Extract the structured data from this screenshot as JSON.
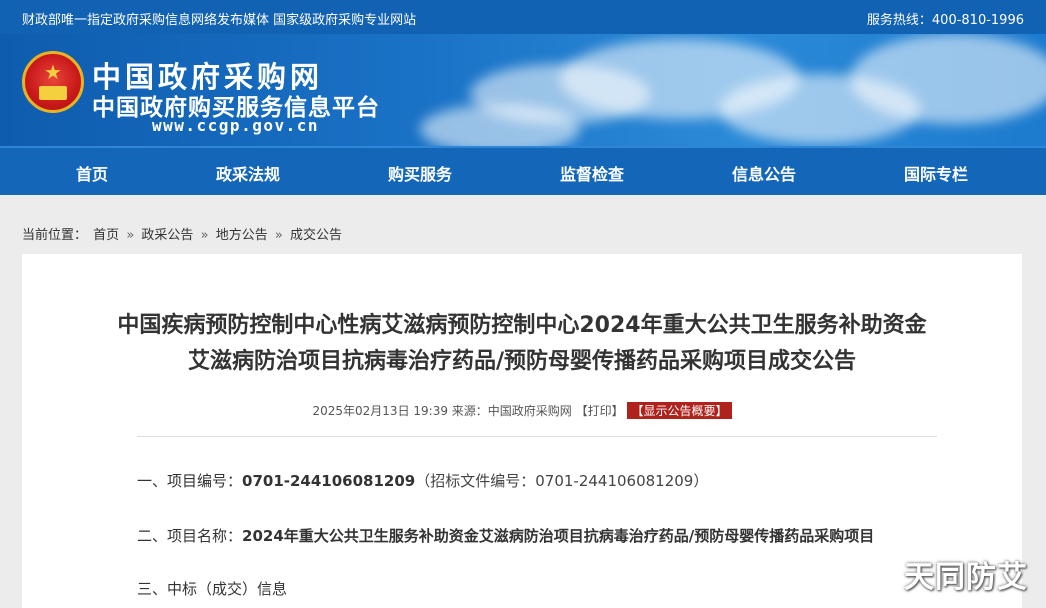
{
  "topbar": {
    "left_text": "财政部唯一指定政府采购信息网络发布媒体 国家级政府采购专业网站",
    "hotline": "服务热线：400-810-1996"
  },
  "logo": {
    "title_line1": "中国政府采购网",
    "title_line2": "中国政府购买服务信息平台",
    "url": "www.ccgp.gov.cn"
  },
  "nav": {
    "items": [
      "首页",
      "政采法规",
      "购买服务",
      "监督检查",
      "信息公告",
      "国际专栏"
    ]
  },
  "breadcrumb": {
    "label": "当前位置：",
    "items": [
      "首页",
      "政采公告",
      "地方公告",
      "成交公告"
    ],
    "separator": "»"
  },
  "article": {
    "title_line1": "中国疾病预防控制中心性病艾滋病预防控制中心2024年重大公共卫生服务补助资金",
    "title_line2": "艾滋病防治项目抗病毒治疗药品/预防母婴传播药品采购项目成交公告",
    "meta_date": "2025年02月13日 19:39",
    "meta_source": "来源：中国政府采购网",
    "meta_print": "【打印】",
    "meta_summary": "【显示公告概要】",
    "section1_label": "一、项目编号：",
    "section1_value": "0701-244106081209",
    "section1_extra": "（招标文件编号：0701-244106081209）",
    "section2_label": "二、项目名称：",
    "section2_value": "2024年重大公共卫生服务补助资金艾滋病防治项目抗病毒治疗药品/预防母婴传播药品采购项目",
    "section3_label": "三、中标（成交）信息"
  },
  "watermark": "天同防艾",
  "colors": {
    "brand_blue": "#1262b3",
    "nav_blue": "#1366b8",
    "tag_red": "#b0231c"
  }
}
